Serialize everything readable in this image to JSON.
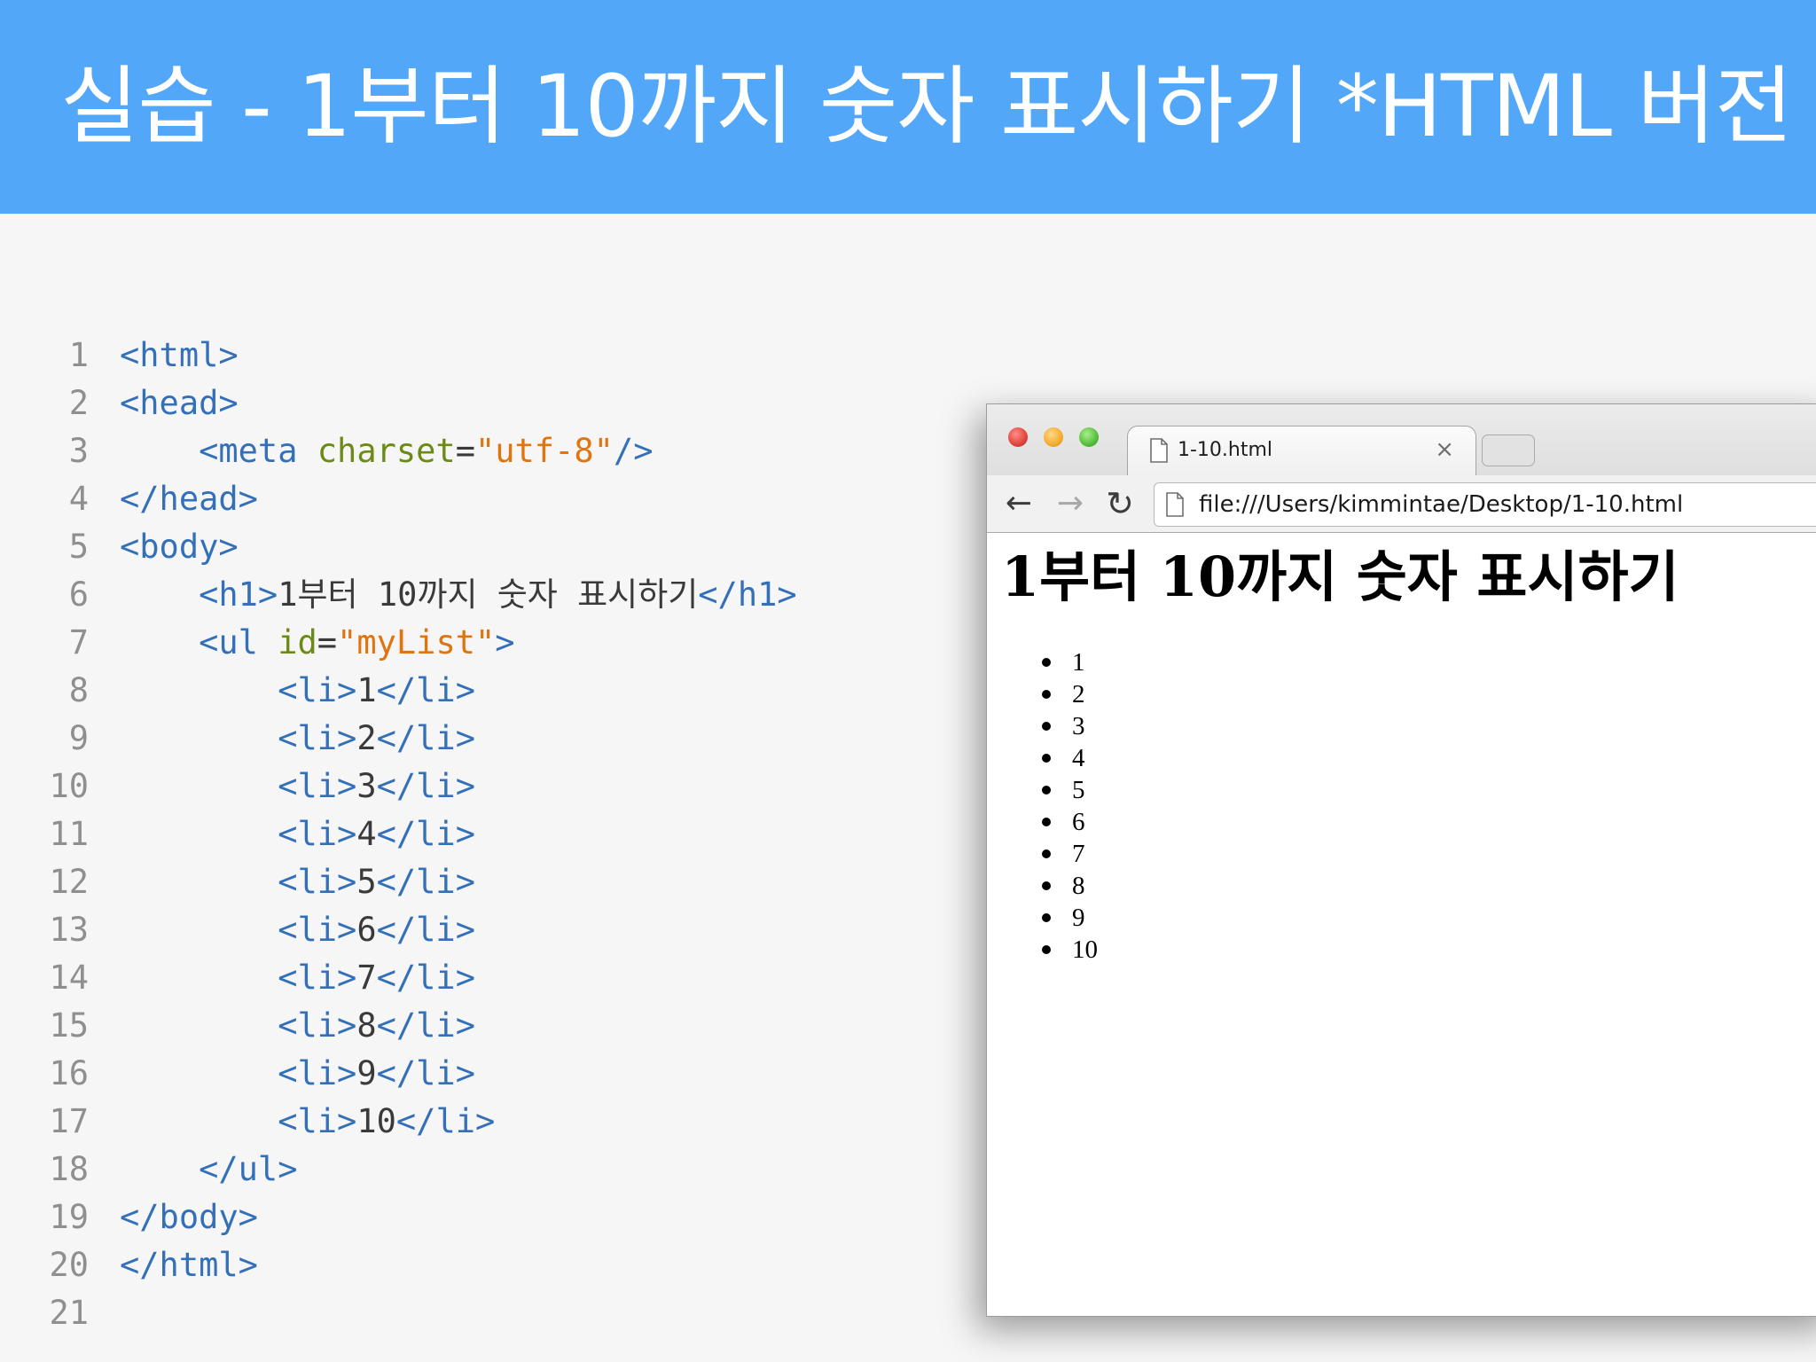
{
  "slide": {
    "title": "실습 - 1부터 10까지 숫자 표시하기 *HTML 버전"
  },
  "editor": {
    "lines": [
      {
        "num": "1",
        "tokens": [
          {
            "t": "<html>",
            "c": "tag"
          }
        ]
      },
      {
        "num": "2",
        "tokens": [
          {
            "t": "<head>",
            "c": "tag"
          }
        ]
      },
      {
        "num": "3",
        "tokens": [
          {
            "t": "    ",
            "c": "txt"
          },
          {
            "t": "<meta ",
            "c": "tag"
          },
          {
            "t": "charset",
            "c": "attr"
          },
          {
            "t": "=",
            "c": "txt"
          },
          {
            "t": "\"utf-8\"",
            "c": "str"
          },
          {
            "t": "/>",
            "c": "tag"
          }
        ]
      },
      {
        "num": "4",
        "tokens": [
          {
            "t": "</head>",
            "c": "tag"
          }
        ]
      },
      {
        "num": "5",
        "tokens": [
          {
            "t": "<body>",
            "c": "tag"
          }
        ]
      },
      {
        "num": "6",
        "tokens": [
          {
            "t": "    ",
            "c": "txt"
          },
          {
            "t": "<h1>",
            "c": "tag"
          },
          {
            "t": "1부터 10까지 숫자 표시하기",
            "c": "txt"
          },
          {
            "t": "</h1>",
            "c": "tag"
          }
        ]
      },
      {
        "num": "7",
        "tokens": [
          {
            "t": "    ",
            "c": "txt"
          },
          {
            "t": "<ul ",
            "c": "tag"
          },
          {
            "t": "id",
            "c": "attr"
          },
          {
            "t": "=",
            "c": "txt"
          },
          {
            "t": "\"myList\"",
            "c": "str"
          },
          {
            "t": ">",
            "c": "tag"
          }
        ]
      },
      {
        "num": "8",
        "tokens": [
          {
            "t": "        ",
            "c": "txt"
          },
          {
            "t": "<li>",
            "c": "tag"
          },
          {
            "t": "1",
            "c": "txt"
          },
          {
            "t": "</li>",
            "c": "tag"
          }
        ]
      },
      {
        "num": "9",
        "tokens": [
          {
            "t": "        ",
            "c": "txt"
          },
          {
            "t": "<li>",
            "c": "tag"
          },
          {
            "t": "2",
            "c": "txt"
          },
          {
            "t": "</li>",
            "c": "tag"
          }
        ]
      },
      {
        "num": "10",
        "tokens": [
          {
            "t": "        ",
            "c": "txt"
          },
          {
            "t": "<li>",
            "c": "tag"
          },
          {
            "t": "3",
            "c": "txt"
          },
          {
            "t": "</li>",
            "c": "tag"
          }
        ]
      },
      {
        "num": "11",
        "tokens": [
          {
            "t": "        ",
            "c": "txt"
          },
          {
            "t": "<li>",
            "c": "tag"
          },
          {
            "t": "4",
            "c": "txt"
          },
          {
            "t": "</li>",
            "c": "tag"
          }
        ]
      },
      {
        "num": "12",
        "tokens": [
          {
            "t": "        ",
            "c": "txt"
          },
          {
            "t": "<li>",
            "c": "tag"
          },
          {
            "t": "5",
            "c": "txt"
          },
          {
            "t": "</li>",
            "c": "tag"
          }
        ]
      },
      {
        "num": "13",
        "tokens": [
          {
            "t": "        ",
            "c": "txt"
          },
          {
            "t": "<li>",
            "c": "tag"
          },
          {
            "t": "6",
            "c": "txt"
          },
          {
            "t": "</li>",
            "c": "tag"
          }
        ]
      },
      {
        "num": "14",
        "tokens": [
          {
            "t": "        ",
            "c": "txt"
          },
          {
            "t": "<li>",
            "c": "tag"
          },
          {
            "t": "7",
            "c": "txt"
          },
          {
            "t": "</li>",
            "c": "tag"
          }
        ]
      },
      {
        "num": "15",
        "tokens": [
          {
            "t": "        ",
            "c": "txt"
          },
          {
            "t": "<li>",
            "c": "tag"
          },
          {
            "t": "8",
            "c": "txt"
          },
          {
            "t": "</li>",
            "c": "tag"
          }
        ]
      },
      {
        "num": "16",
        "tokens": [
          {
            "t": "        ",
            "c": "txt"
          },
          {
            "t": "<li>",
            "c": "tag"
          },
          {
            "t": "9",
            "c": "txt"
          },
          {
            "t": "</li>",
            "c": "tag"
          }
        ]
      },
      {
        "num": "17",
        "tokens": [
          {
            "t": "        ",
            "c": "txt"
          },
          {
            "t": "<li>",
            "c": "tag"
          },
          {
            "t": "10",
            "c": "txt"
          },
          {
            "t": "</li>",
            "c": "tag"
          }
        ]
      },
      {
        "num": "18",
        "tokens": [
          {
            "t": "    ",
            "c": "txt"
          },
          {
            "t": "</ul>",
            "c": "tag"
          }
        ]
      },
      {
        "num": "19",
        "tokens": [
          {
            "t": "</body>",
            "c": "tag"
          }
        ]
      },
      {
        "num": "20",
        "tokens": [
          {
            "t": "</html>",
            "c": "tag"
          }
        ]
      },
      {
        "num": "21",
        "tokens": []
      }
    ]
  },
  "browser": {
    "tab_title": "1-10.html",
    "tab_close": "×",
    "url": "file:///Users/kimmintae/Desktop/1-10.html",
    "page": {
      "heading": "1부터 10까지 숫자 표시하기",
      "items": [
        "1",
        "2",
        "3",
        "4",
        "5",
        "6",
        "7",
        "8",
        "9",
        "10"
      ]
    }
  },
  "icons": {
    "back": "arrow-left",
    "forward": "arrow-right",
    "reload": "reload",
    "doc": "document",
    "close": "close",
    "new_tab": "new-tab"
  },
  "colors": {
    "header_bg": "#52a7f9",
    "tag": "#3470b8",
    "attr": "#6b8a16",
    "string": "#e0740f"
  }
}
